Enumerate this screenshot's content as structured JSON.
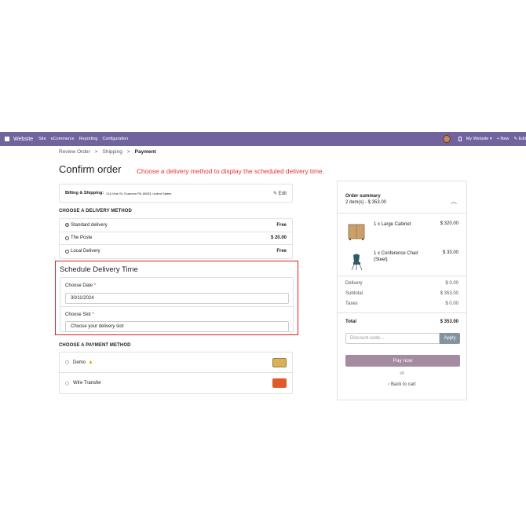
{
  "navbar": {
    "brand": "Website",
    "menu": [
      "Site",
      "eCommerce",
      "Reporting",
      "Configuration"
    ],
    "website_switch": "My Website ▾",
    "new_label": "+ New",
    "edit_label": "✎ Edit"
  },
  "breadcrumb": {
    "step1": "Review Order",
    "step2": "Shipping",
    "step3": "Payment",
    "sep": ">"
  },
  "title": "Confirm order",
  "hint": "Choose a delivery method to display the scheduled delivery time.",
  "billing": {
    "label": "Billing & Shipping:",
    "address": "215 Vine St, Scranton PA 18503, United States",
    "edit": "✎ Edit"
  },
  "delivery": {
    "heading": "CHOOSE A DELIVERY METHOD",
    "methods": [
      {
        "label": "Standard delivery",
        "price": "Free",
        "selected": true
      },
      {
        "label": "The Poste",
        "price": "$ 20.00",
        "selected": false
      },
      {
        "label": "Local Delivery",
        "price": "Free",
        "selected": false
      }
    ]
  },
  "schedule": {
    "title": "Schedule Delivery Time",
    "date_label": "Choose Date",
    "date_value": "30/11/2024",
    "slot_label": "Choose Slot",
    "slot_value": "Choose your delivery slot",
    "required_mark": "*"
  },
  "payment": {
    "heading": "CHOOSE A PAYMENT METHOD",
    "methods": [
      {
        "label": "Demo"
      },
      {
        "label": "Wire Transfer"
      }
    ]
  },
  "summary": {
    "title": "Order summary",
    "subtitle": "2 item(s) -  $ 353.00",
    "items": [
      {
        "name": "1 x Large Cabinet",
        "price": "$ 320.00"
      },
      {
        "name": "1 x Conference Chair (Steel)",
        "price": "$ 33.00"
      }
    ],
    "delivery_label": "Delivery",
    "delivery_value": "$ 0.00",
    "subtotal_label": "Subtotal",
    "subtotal_value": "$ 353.00",
    "taxes_label": "Taxes",
    "taxes_value": "$ 0.00",
    "total_label": "Total",
    "total_value": "$ 353.00",
    "discount_placeholder": "Discount code...",
    "apply": "Apply",
    "pay_now": "Pay now",
    "or": "or",
    "back": "‹  Back to cart"
  },
  "colors": {
    "navbar": "#71639e",
    "hint": "#e53535",
    "highlight_border": "#e02020",
    "pay_button": "#a38ba0",
    "apply_button": "#8393a0"
  }
}
